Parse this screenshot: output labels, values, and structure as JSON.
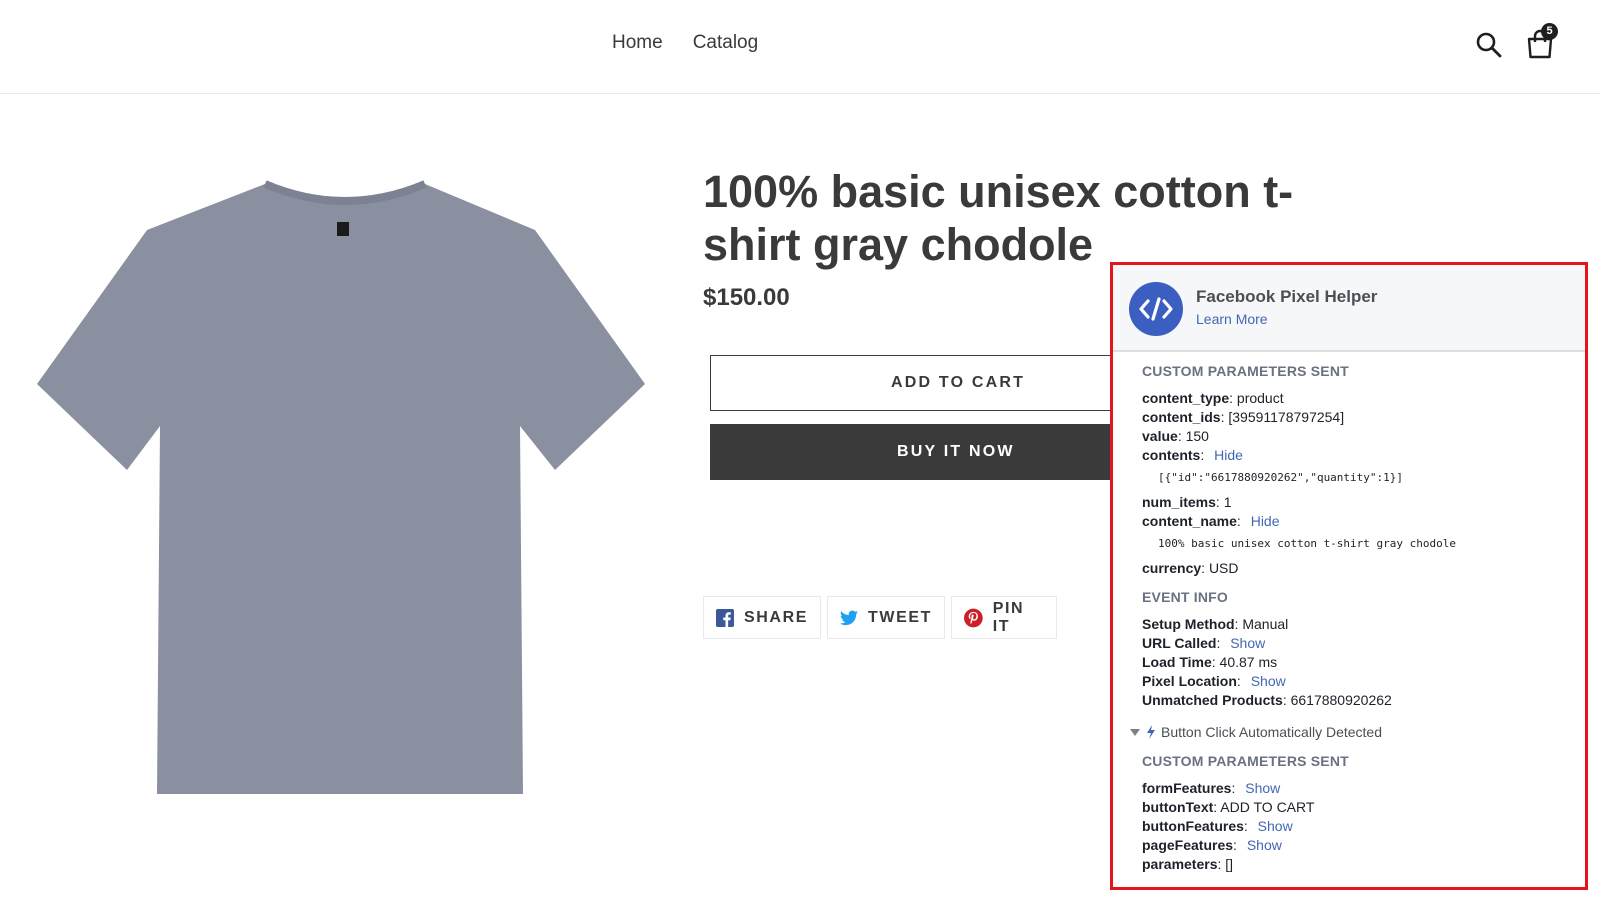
{
  "nav": {
    "items": [
      "Home",
      "Catalog"
    ]
  },
  "cart": {
    "count": "5"
  },
  "icons": {
    "search": "search-icon",
    "cart": "shopping-bag-icon",
    "facebook": "facebook-icon",
    "twitter": "twitter-icon",
    "pinterest": "pinterest-icon",
    "helper_logo": "code-icon",
    "lightning": "lightning-icon",
    "caret": "caret-down-icon"
  },
  "colors": {
    "text": "#3a3a3a",
    "button_dark": "#3a3a3a",
    "facebook": "#3b5998",
    "twitter": "#1da1f2",
    "pinterest": "#cb2027",
    "helper_link": "#4267b2",
    "helper_border": "#e3141b",
    "helper_logo": "#3b5fc0"
  },
  "product": {
    "title": "100% basic unisex cotton t-shirt gray chodole",
    "price": "$150.00",
    "add_to_cart": "ADD TO CART",
    "buy_now": "BUY IT NOW",
    "image_desc": "gray t-shirt"
  },
  "share": {
    "facebook": "SHARE",
    "twitter": "TWEET",
    "pinterest": "PIN IT"
  },
  "helper": {
    "title": "Facebook Pixel Helper",
    "learn_more": "Learn More",
    "section1": {
      "heading": "CUSTOM PARAMETERS SENT",
      "content_type_key": "content_type",
      "content_type_val": "product",
      "content_ids_key": "content_ids",
      "content_ids_val": "[39591178797254]",
      "value_key": "value",
      "value_val": "150",
      "contents_key": "contents",
      "contents_link": "Hide",
      "contents_json": "[{\"id\":\"6617880920262\",\"quantity\":1}]",
      "num_items_key": "num_items",
      "num_items_val": "1",
      "content_name_key": "content_name",
      "content_name_link": "Hide",
      "content_name_text": "100% basic unisex cotton t-shirt gray chodole",
      "currency_key": "currency",
      "currency_val": "USD"
    },
    "event_info": {
      "heading": "EVENT INFO",
      "setup_key": "Setup Method",
      "setup_val": "Manual",
      "url_key": "URL Called",
      "url_link": "Show",
      "load_key": "Load Time",
      "load_val": "40.87 ms",
      "pixel_key": "Pixel Location",
      "pixel_link": "Show",
      "unmatched_key": "Unmatched Products",
      "unmatched_val": "6617880920262"
    },
    "event2": {
      "label": "Button Click Automatically Detected"
    },
    "section2": {
      "heading": "CUSTOM PARAMETERS SENT",
      "form_key": "formFeatures",
      "form_link": "Show",
      "btntext_key": "buttonText",
      "btntext_val": "ADD TO CART",
      "btnfeat_key": "buttonFeatures",
      "btnfeat_link": "Show",
      "page_key": "pageFeatures",
      "page_link": "Show",
      "params_key": "parameters",
      "params_val": "[]"
    }
  }
}
